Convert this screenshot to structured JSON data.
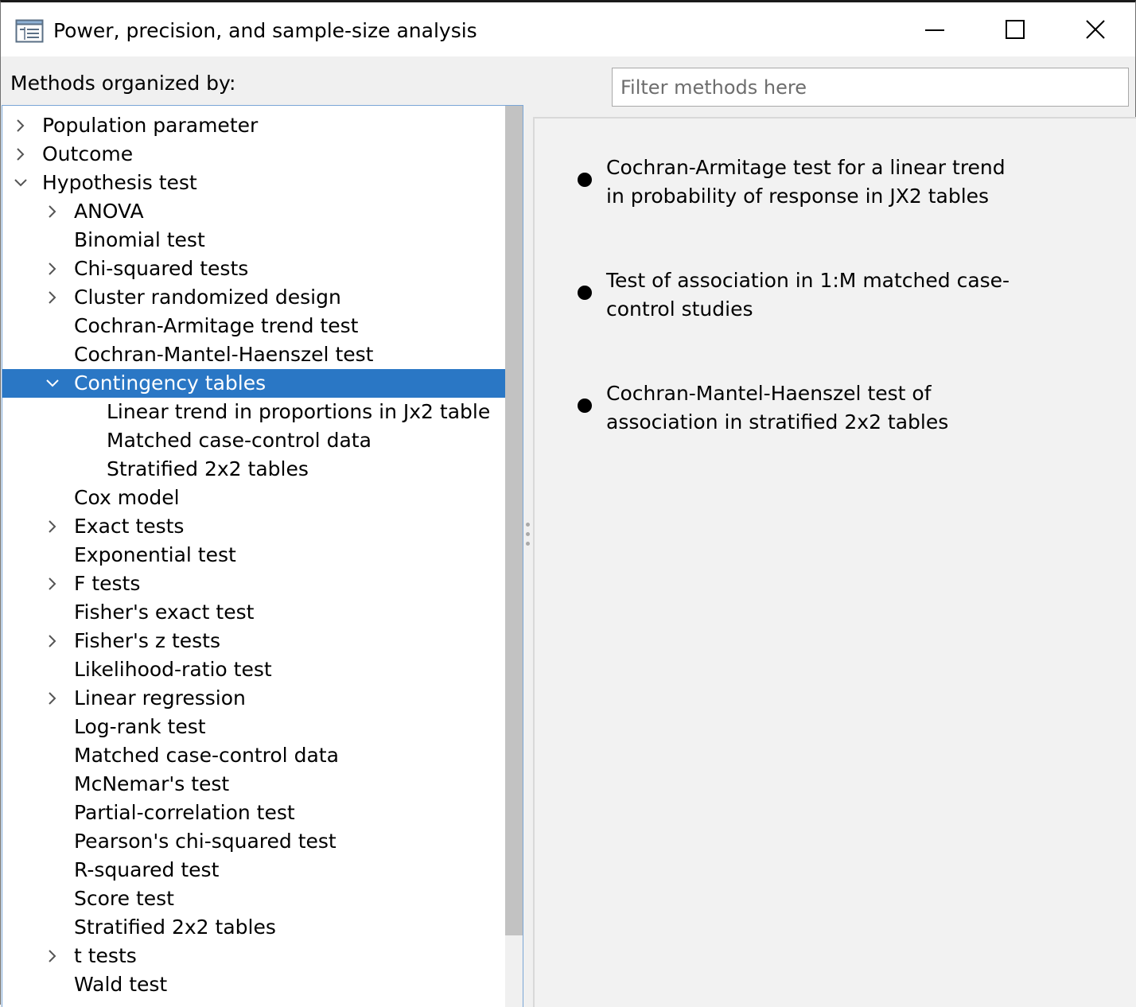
{
  "window": {
    "title": "Power, precision, and sample-size analysis",
    "minimize_icon": "minimize-icon",
    "maximize_icon": "maximize-icon",
    "close_icon": "close-icon"
  },
  "methods_label": "Methods organized by:",
  "filter": {
    "placeholder": "Filter methods here",
    "value": ""
  },
  "tree": [
    {
      "level": 0,
      "label": "Population parameter",
      "toggle": "collapsed"
    },
    {
      "level": 0,
      "label": "Outcome",
      "toggle": "collapsed"
    },
    {
      "level": 0,
      "label": "Hypothesis test",
      "toggle": "expanded"
    },
    {
      "level": 1,
      "label": "ANOVA",
      "toggle": "collapsed"
    },
    {
      "level": 1,
      "label": "Binomial test",
      "toggle": "none"
    },
    {
      "level": 1,
      "label": "Chi-squared tests",
      "toggle": "collapsed"
    },
    {
      "level": 1,
      "label": "Cluster randomized design",
      "toggle": "collapsed"
    },
    {
      "level": 1,
      "label": "Cochran-Armitage trend test",
      "toggle": "none"
    },
    {
      "level": 1,
      "label": "Cochran-Mantel-Haenszel test",
      "toggle": "none"
    },
    {
      "level": 1,
      "label": "Contingency tables",
      "toggle": "expanded",
      "selected": true
    },
    {
      "level": 2,
      "label": "Linear trend in proportions in Jx2 table",
      "toggle": "none"
    },
    {
      "level": 2,
      "label": "Matched case-control data",
      "toggle": "none"
    },
    {
      "level": 2,
      "label": "Stratified 2x2 tables",
      "toggle": "none"
    },
    {
      "level": 1,
      "label": "Cox model",
      "toggle": "none"
    },
    {
      "level": 1,
      "label": "Exact tests",
      "toggle": "collapsed"
    },
    {
      "level": 1,
      "label": "Exponential test",
      "toggle": "none"
    },
    {
      "level": 1,
      "label": "F tests",
      "toggle": "collapsed"
    },
    {
      "level": 1,
      "label": "Fisher's exact test",
      "toggle": "none"
    },
    {
      "level": 1,
      "label": "Fisher's z tests",
      "toggle": "collapsed"
    },
    {
      "level": 1,
      "label": "Likelihood-ratio test",
      "toggle": "none"
    },
    {
      "level": 1,
      "label": "Linear regression",
      "toggle": "collapsed"
    },
    {
      "level": 1,
      "label": "Log-rank test",
      "toggle": "none"
    },
    {
      "level": 1,
      "label": "Matched case-control data",
      "toggle": "none"
    },
    {
      "level": 1,
      "label": "McNemar's test",
      "toggle": "none"
    },
    {
      "level": 1,
      "label": "Partial-correlation test",
      "toggle": "none"
    },
    {
      "level": 1,
      "label": "Pearson's chi-squared test",
      "toggle": "none"
    },
    {
      "level": 1,
      "label": "R-squared test",
      "toggle": "none"
    },
    {
      "level": 1,
      "label": "Score test",
      "toggle": "none"
    },
    {
      "level": 1,
      "label": "Stratified 2x2 tables",
      "toggle": "none"
    },
    {
      "level": 1,
      "label": "t tests",
      "toggle": "collapsed"
    },
    {
      "level": 1,
      "label": "Wald test",
      "toggle": "none"
    }
  ],
  "methods": [
    "Cochran-Armitage test for a linear trend in probability of response in JX2 tables",
    "Test of association in 1:M matched case-control studies",
    "Cochran-Mantel-Haenszel test of association in stratified 2x2 tables"
  ],
  "colors": {
    "selection": "#2a77c5",
    "selection_text": "#ffffff"
  }
}
